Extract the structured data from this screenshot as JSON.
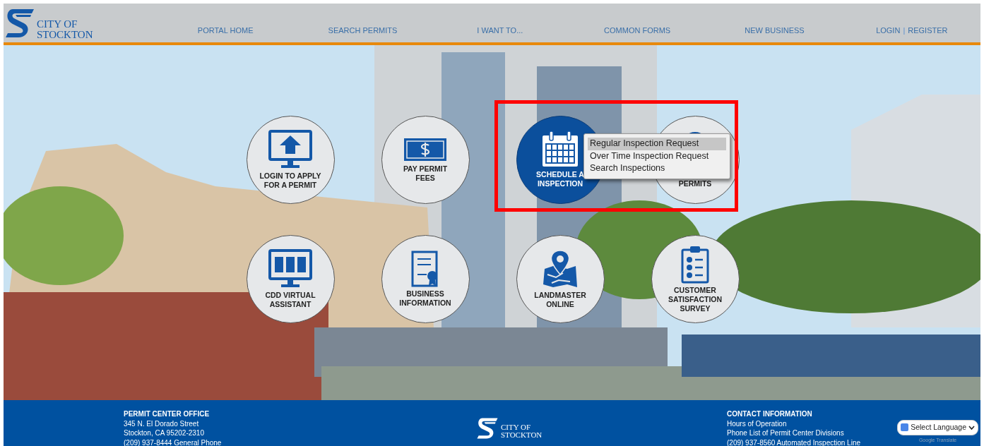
{
  "header": {
    "logo": {
      "line_1": "CITY OF",
      "line_2": "STOCKTON"
    },
    "nav": [
      {
        "label": "PORTAL HOME"
      },
      {
        "label": "SEARCH PERMITS"
      },
      {
        "label": "I WANT TO..."
      },
      {
        "label": "COMMON FORMS"
      },
      {
        "label": "NEW BUSINESS"
      }
    ],
    "account": {
      "login": "LOGIN",
      "separator": "|",
      "register": "REGISTER"
    }
  },
  "tiles": [
    {
      "kind": "upload",
      "lines": [
        "LOGIN TO APPLY",
        "FOR A PERMIT"
      ],
      "selected": false
    },
    {
      "kind": "payment",
      "lines": [
        "PAY PERMIT",
        "FEES"
      ],
      "selected": false
    },
    {
      "kind": "calendar",
      "lines": [
        "SCHEDULE A",
        "INSPECTION"
      ],
      "selected": true
    },
    {
      "kind": "globe",
      "lines": [
        "PERMITS"
      ],
      "selected": false
    },
    {
      "kind": "assistant",
      "lines": [
        "CDD VIRTUAL",
        "ASSISTANT"
      ],
      "selected": false
    },
    {
      "kind": "document",
      "lines": [
        "BUSINESS",
        "INFORMATION"
      ],
      "selected": false
    },
    {
      "kind": "map",
      "lines": [
        "LANDMASTER",
        "ONLINE"
      ],
      "selected": false
    },
    {
      "kind": "checklist",
      "lines": [
        "CUSTOMER",
        "SATISFACTION",
        "SURVEY"
      ],
      "selected": false
    }
  ],
  "dropdown": {
    "items": [
      {
        "label": "Regular Inspection Request",
        "selected": true
      },
      {
        "label": "Over Time Inspection Request",
        "selected": false
      },
      {
        "label": "Search Inspections",
        "selected": false
      }
    ]
  },
  "highlight_frame": true,
  "footer": {
    "office": {
      "title": "PERMIT CENTER OFFICE",
      "lines": [
        "345 N. El Dorado Street",
        "Stockton, CA 95202-2310",
        "(209) 937-8444 General Phone"
      ]
    },
    "logo": {
      "line_1": "CITY OF",
      "line_2": "STOCKTON"
    },
    "contact": {
      "title": "CONTACT INFORMATION",
      "lines": [
        "Hours of Operation",
        "Phone List of Permit Center Divisions",
        "(209) 937-8560 Automated Inspection Line"
      ]
    },
    "language": {
      "value": "Select Language",
      "powered_by": "Google Translate"
    }
  }
}
